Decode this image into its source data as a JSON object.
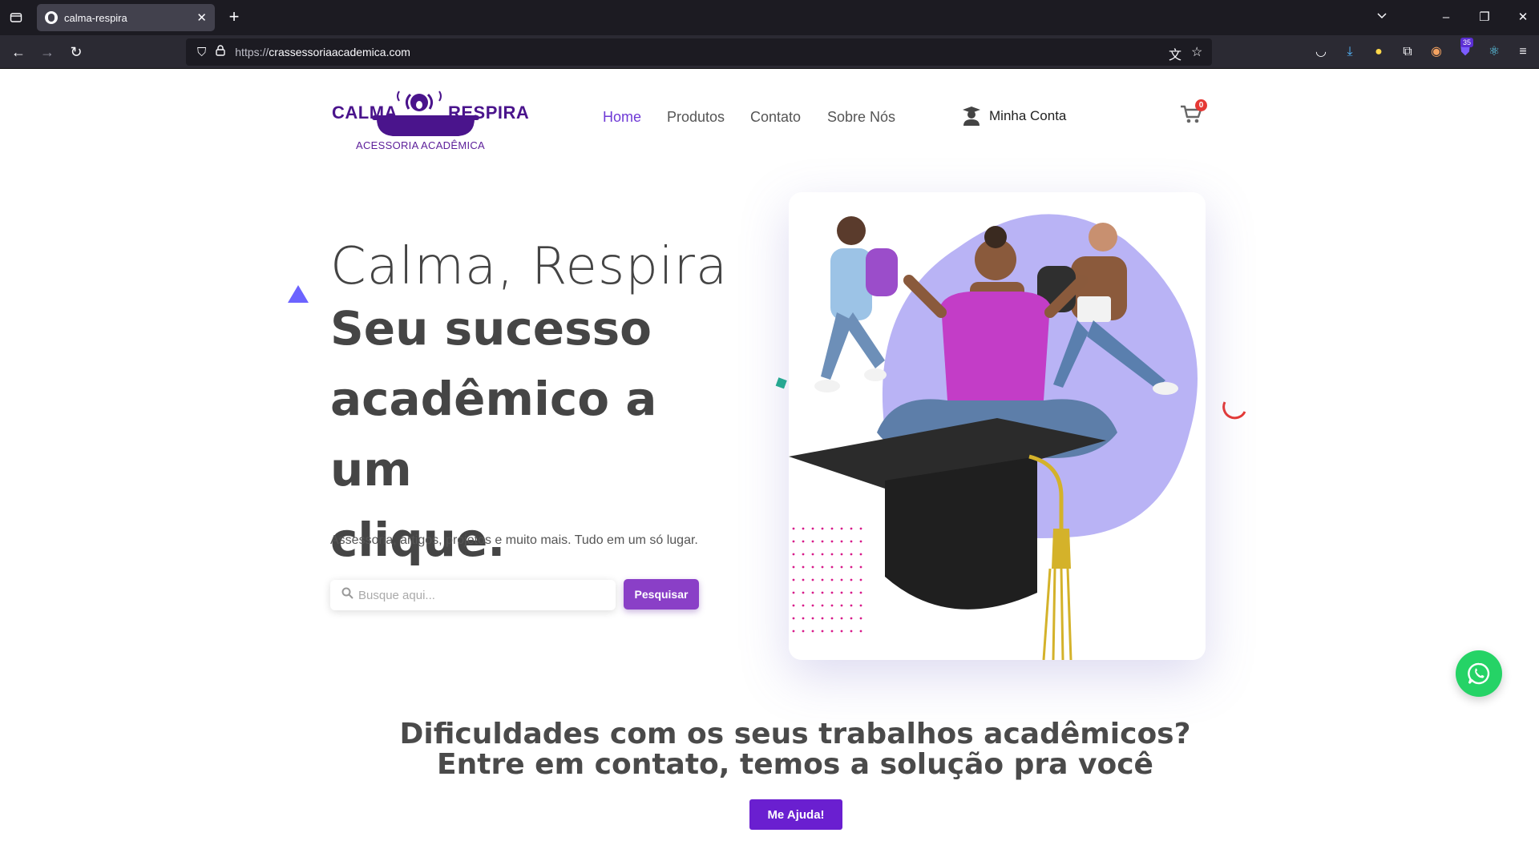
{
  "browser": {
    "tab_title": "calma-respira",
    "url_prefix": "https://",
    "url_host": "crassessoriaacademica.com",
    "extension_badge": "35"
  },
  "header": {
    "logo_left": "CALMA",
    "logo_right": "RESPIRA",
    "logo_sub": "ACESSORIA ACADÊMICA",
    "menu": [
      {
        "label": "Home"
      },
      {
        "label": "Produtos"
      },
      {
        "label": "Contato"
      },
      {
        "label": "Sobre Nós"
      }
    ],
    "account_label": "Minha Conta",
    "cart_count": "0"
  },
  "hero": {
    "title_light": "Calma, Respira",
    "title_bold_1": "Seu sucesso",
    "title_bold_2": "acadêmico a um",
    "title_bold_3": "clique.",
    "subtitle": "Assessoria, artigos, projetos e muito mais. Tudo em um só lugar.",
    "search_placeholder": "Busque aqui...",
    "search_button": "Pesquisar"
  },
  "cta": {
    "line1": "Dificuldades com os seus trabalhos acadêmicos?",
    "line2": "Entre em contato, temos a solução pra você",
    "button": "Me Ajuda!"
  },
  "colors": {
    "brand_purple": "#4a148c",
    "accent_purple": "#8a3fc7",
    "cta_purple": "#6a1fd0",
    "whatsapp_green": "#25d366"
  }
}
